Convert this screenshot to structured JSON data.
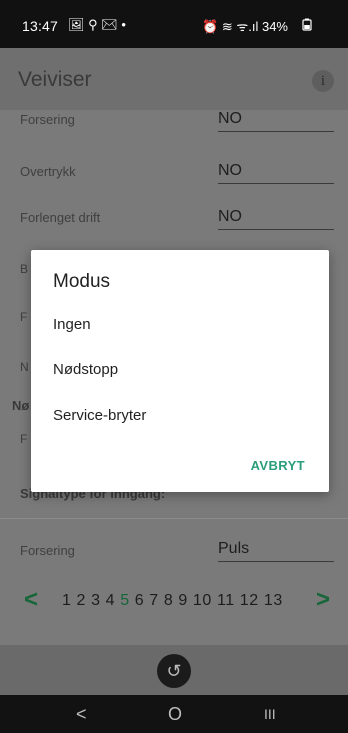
{
  "status_bar": {
    "time": "13:47",
    "left_icons": "🖼 ⚲ ✉ •",
    "right_icons": "⏰ ≋ ᯤ.ıl 34%",
    "battery_icon": "battery-icon"
  },
  "app_bar": {
    "title": "Veiviser",
    "info_glyph": "i"
  },
  "form": {
    "top_partial_label": "Forsering",
    "top_partial_value": "NO",
    "rows": [
      {
        "label": "Overtrykk",
        "value": "NO"
      },
      {
        "label": "Forlenget drift",
        "value": "NO"
      }
    ],
    "hidden_label_a": "B",
    "hidden_label_b": "F",
    "hidden_label_c": "N",
    "section_partial": "Nø",
    "hidden_label_d": "F",
    "signal_section_title": "Signaltype for inngang:",
    "bottom_row": {
      "label": "Forsering",
      "value": "Puls"
    }
  },
  "pager": {
    "prev": "<",
    "next": ">",
    "pages_before": "1 2 3 4 ",
    "current": "5",
    "pages_after": " 6 7 8 9 10 11 12 13"
  },
  "back_button_glyph": "↺",
  "nav_bar": {
    "back": "<",
    "home": "O",
    "recents": "III"
  },
  "dialog": {
    "title": "Modus",
    "options": [
      "Ingen",
      "Nødstopp",
      "Service-bryter"
    ],
    "cancel_label": "AVBRYT"
  },
  "colors": {
    "accent": "#2a9d7a",
    "pager_accent": "#16663a"
  }
}
